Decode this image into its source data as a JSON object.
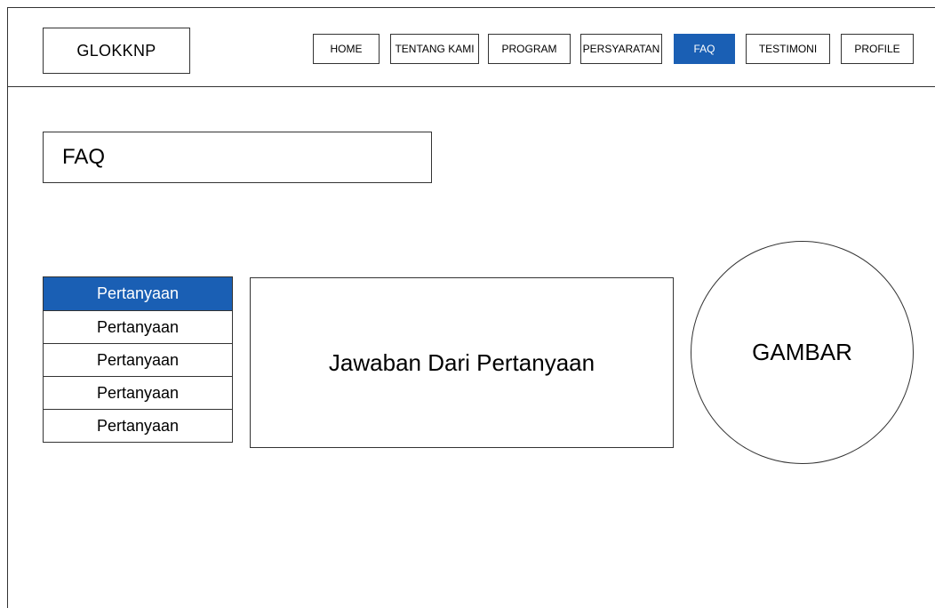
{
  "brand": {
    "logo_text": "GLOKKNP"
  },
  "nav": {
    "items": [
      {
        "label": "HOME"
      },
      {
        "label": "TENTANG KAMI"
      },
      {
        "label": "PROGRAM"
      },
      {
        "label": "PERSYARATAN"
      },
      {
        "label": "FAQ"
      },
      {
        "label": "TESTIMONI"
      },
      {
        "label": "PROFILE"
      }
    ],
    "active_label": "FAQ"
  },
  "main": {
    "title": "FAQ",
    "questions": [
      {
        "label": "Pertanyaan"
      },
      {
        "label": "Pertanyaan"
      },
      {
        "label": "Pertanyaan"
      },
      {
        "label": "Pertanyaan"
      },
      {
        "label": "Pertanyaan"
      }
    ],
    "selected_question_index": 0,
    "answer_text": "Jawaban Dari Pertanyaan",
    "image_placeholder": "GAMBAR"
  },
  "colors": {
    "accent": "#1a5fb4",
    "border": "#333333",
    "background": "#ffffff"
  }
}
